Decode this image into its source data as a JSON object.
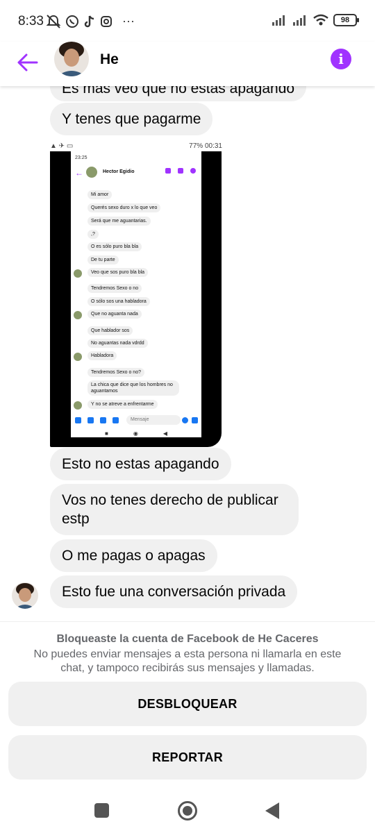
{
  "status_bar": {
    "time": "8:33",
    "battery": "98",
    "more": "···"
  },
  "header": {
    "contact_name": "He",
    "info_glyph": "i"
  },
  "messages": [
    {
      "text": "Es más veo que no estas apagando"
    },
    {
      "text": "Y tenes que pagarme"
    },
    {
      "text": "Esto no estas apagando"
    },
    {
      "text": "Vos no tenes derecho de publicar estp"
    },
    {
      "text": "O me pagas o apagas"
    },
    {
      "text": "Esto fue una conversación privada"
    }
  ],
  "embedded_screenshot": {
    "outer_status_right": "77% 00:31",
    "inner_time": "23:25",
    "contact_name": "Hector Egidio",
    "composer_placeholder": "Mensaje",
    "messages": [
      "Mi amor",
      "Querés sexo duro x lo que veo",
      "Será que me aguantarias.",
      ",?",
      "O es sólo puro bla bla",
      "De tu parte",
      "Veo que sos puro bla bla",
      "Tendremos Sexo o no",
      "O sólo sos una habladora",
      "Que no aguanta nada",
      "Que hablador sos",
      "No aguantas nada vdrdd",
      "Habladora",
      "Tendremos Sexo o no?",
      "La chica que dice que los hombres no aguantamos",
      "Y no se atreve a enfrentarme"
    ]
  },
  "blocked_panel": {
    "title": "Bloqueaste la cuenta de Facebook de He Caceres",
    "description": "No puedes enviar mensajes a esta persona ni llamarla en este chat, y tampoco recibirás sus mensajes y llamadas.",
    "unblock_label": "DESBLOQUEAR",
    "report_label": "REPORTAR"
  },
  "colors": {
    "accent": "#a033ff",
    "bubble": "#f0f0f0",
    "muted_text": "#65676b"
  }
}
